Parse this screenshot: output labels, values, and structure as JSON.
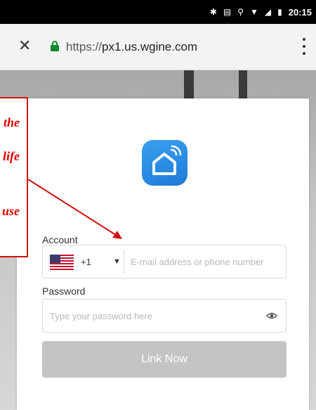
{
  "status_bar": {
    "time": "20:15",
    "icons": [
      "bluetooth-icon",
      "vibrate-icon",
      "key-icon",
      "wifi-icon",
      "no-signal-icon",
      "battery-icon"
    ]
  },
  "browser": {
    "close_icon": "close-icon",
    "lock_icon": "lock-icon",
    "url_scheme": "https://",
    "url_host": "px1.us.wgine.com",
    "menu_icon": "more-vert-icon"
  },
  "login": {
    "account_label": "Account",
    "country_code": "+1",
    "account_placeholder": "E-mail address or phone number",
    "password_label": "Password",
    "password_placeholder": "Type your password here",
    "link_button": "Link Now",
    "logo_icon": "smart-home-icon"
  },
  "annotation": {
    "lines": [
      "the",
      "life",
      "use"
    ]
  },
  "colors": {
    "accent": "#2a8ae6",
    "button_disabled": "#c4c4c4",
    "annotation": "#e00000"
  }
}
